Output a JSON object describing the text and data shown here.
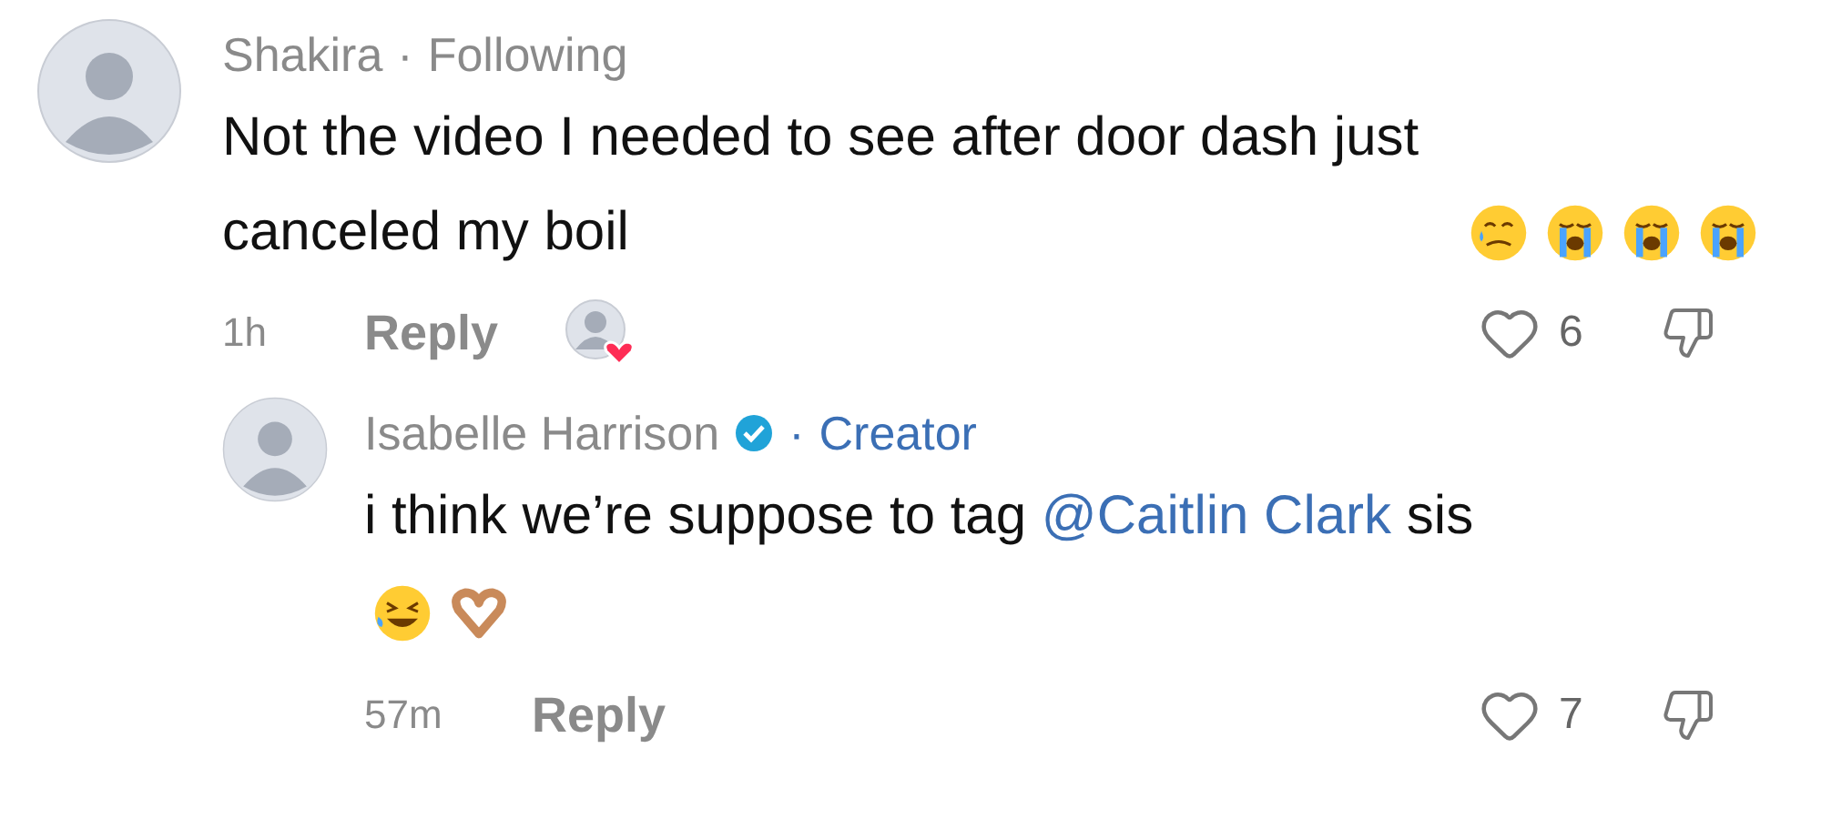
{
  "comment": {
    "author": "Shakira",
    "separator": "·",
    "relation": "Following",
    "text": "Not the video I needed to see after door dash just canceled my boil",
    "time": "1h",
    "reply_label": "Reply",
    "liked_by_creator": true,
    "likes": "6",
    "liked": false,
    "reply": {
      "author": "Isabelle Harrison",
      "verified": true,
      "separator": "·",
      "badge": "Creator",
      "text": {
        "before": "i think we’re suppose to tag ",
        "mention": "@Caitlin Clark",
        "after": " sis"
      },
      "time": "57m",
      "reply_label": "Reply",
      "likes": "7",
      "liked": false
    }
  }
}
